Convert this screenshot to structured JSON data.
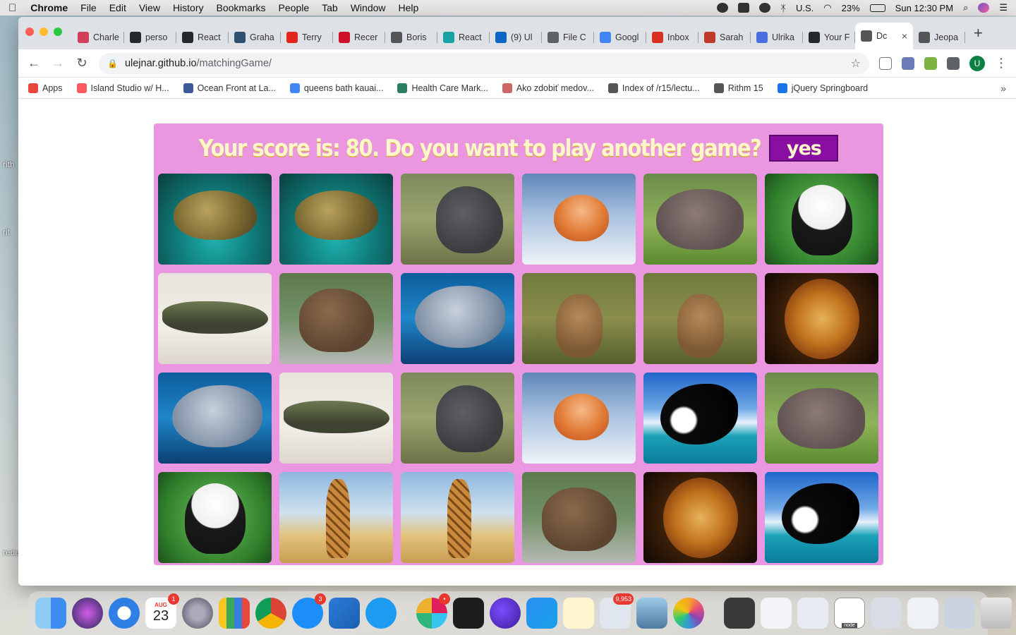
{
  "menubar": {
    "app_name": "Chrome",
    "items": [
      "File",
      "Edit",
      "View",
      "History",
      "Bookmarks",
      "People",
      "Tab",
      "Window",
      "Help"
    ],
    "input_source": "U.S.",
    "battery": "23%",
    "clock": "Sun 12:30 PM"
  },
  "desktop": {
    "labels": [
      "rith",
      "rit",
      "redu"
    ]
  },
  "tabs": [
    {
      "label": "Charle",
      "color": "#d23f5a"
    },
    {
      "label": "perso",
      "color": "#24292e"
    },
    {
      "label": "React",
      "color": "#24292e"
    },
    {
      "label": "Graha",
      "color": "#2f4f6f"
    },
    {
      "label": "Terry",
      "color": "#e2261c"
    },
    {
      "label": "Recer",
      "color": "#d0112b"
    },
    {
      "label": "Boris",
      "color": "#555555"
    },
    {
      "label": "React",
      "color": "#1aa1a3"
    },
    {
      "label": "(9) Ul",
      "color": "#0a66c2"
    },
    {
      "label": "File C",
      "color": "#5f6368"
    },
    {
      "label": "Googl",
      "color": "#4285f4"
    },
    {
      "label": "Inbox",
      "color": "#d93025"
    },
    {
      "label": "Sarah",
      "color": "#c0392b"
    },
    {
      "label": "Ulrika",
      "color": "#4a6ee0"
    },
    {
      "label": "Your F",
      "color": "#24292e"
    },
    {
      "label": "Dc",
      "color": "#555555",
      "active": true
    },
    {
      "label": "Jeopa",
      "color": "#555555"
    }
  ],
  "toolbar": {
    "url_host": "ulejnar.github.io",
    "url_path": "/matchingGame/",
    "profile_initial": "U"
  },
  "bookmarks": [
    {
      "label": "Apps",
      "color": "#e8453c"
    },
    {
      "label": "Island Studio w/ H...",
      "color": "#ff5a5f"
    },
    {
      "label": "Ocean Front at La...",
      "color": "#3b5998"
    },
    {
      "label": "queens bath kauai...",
      "color": "#4285f4"
    },
    {
      "label": "Health Care Mark...",
      "color": "#2a7f62"
    },
    {
      "label": "Ako zdobiť medov...",
      "color": "#cc6666"
    },
    {
      "label": "Index of /r15/lectu...",
      "color": "#555555"
    },
    {
      "label": "Rithm 15",
      "color": "#555555"
    },
    {
      "label": "jQuery Springboard",
      "color": "#1a73e8"
    }
  ],
  "game": {
    "score_message": "Your score is: 80. Do you want to play another game?",
    "yes_label": "yes",
    "cards": [
      {
        "animal": "sea-turtle"
      },
      {
        "animal": "sea-turtle"
      },
      {
        "animal": "elephant"
      },
      {
        "animal": "fox"
      },
      {
        "animal": "hippo"
      },
      {
        "animal": "panda"
      },
      {
        "animal": "crocodile"
      },
      {
        "animal": "bear"
      },
      {
        "animal": "dolphin"
      },
      {
        "animal": "deer"
      },
      {
        "animal": "deer"
      },
      {
        "animal": "lion"
      },
      {
        "animal": "dolphin"
      },
      {
        "animal": "crocodile"
      },
      {
        "animal": "elephant"
      },
      {
        "animal": "fox"
      },
      {
        "animal": "orca"
      },
      {
        "animal": "hippo"
      },
      {
        "animal": "panda"
      },
      {
        "animal": "giraffe"
      },
      {
        "animal": "giraffe"
      },
      {
        "animal": "bear"
      },
      {
        "animal": "lion"
      },
      {
        "animal": "orca"
      }
    ],
    "colors": {
      "board": "#ea96e1",
      "button": "#8b0ea3",
      "text": "#fff7cc"
    }
  },
  "dock": {
    "calendar_month": "AUG",
    "calendar_day": "23",
    "calendar_badge": "1",
    "appstore_badge": "3",
    "mail_badge": "9,953",
    "terminal_label": "node"
  }
}
